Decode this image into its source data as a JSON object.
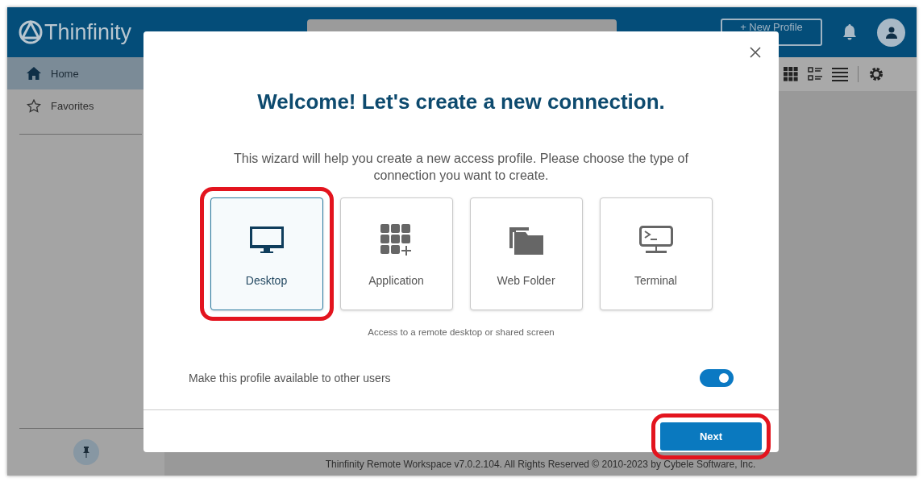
{
  "header": {
    "logo_text": "Thinfinity",
    "new_profile_button": "+ New Profile"
  },
  "sidebar": {
    "items": [
      {
        "label": "Home",
        "kind": "home",
        "selected": true
      },
      {
        "label": "Favorites",
        "kind": "star",
        "selected": false
      }
    ]
  },
  "dialog": {
    "title": "Welcome! Let's create a new connection.",
    "description": "This wizard will help you create a new access profile. Please choose the type of connection you want to create.",
    "connection_types": [
      {
        "label": "Desktop",
        "kind": "desktop",
        "selected": true,
        "highlighted": true
      },
      {
        "label": "Application",
        "kind": "application",
        "selected": false,
        "highlighted": false
      },
      {
        "label": "Web Folder",
        "kind": "folder",
        "selected": false,
        "highlighted": false
      },
      {
        "label": "Terminal",
        "kind": "terminal",
        "selected": false,
        "highlighted": false
      }
    ],
    "type_description": "Access to a remote desktop or shared screen",
    "share_toggle": {
      "label": "Make this profile available to other users",
      "on": true
    },
    "next_button": {
      "label": "Next",
      "highlighted": true
    }
  },
  "footer": {
    "copyright": "Thinfinity Remote Workspace v7.0.2.104. All Rights Reserved © 2010-2023 by Cybele Software, Inc."
  }
}
